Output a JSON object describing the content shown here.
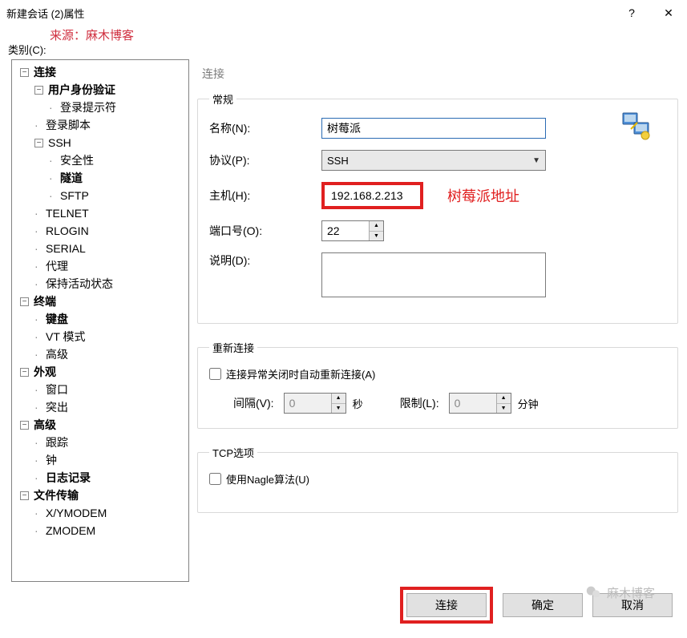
{
  "window": {
    "title": "新建会话 (2)属性",
    "help": "?",
    "close": "✕"
  },
  "watermark_top": "来源：麻木博客",
  "category_label": "类别(C):",
  "tree": {
    "connection": "连接",
    "user_auth": "用户身份验证",
    "login_prompt": "登录提示符",
    "login_script": "登录脚本",
    "ssh": "SSH",
    "security": "安全性",
    "tunnel": "隧道",
    "sftp": "SFTP",
    "telnet": "TELNET",
    "rlogin": "RLOGIN",
    "serial": "SERIAL",
    "proxy": "代理",
    "keepalive": "保持活动状态",
    "terminal": "终端",
    "keyboard": "键盘",
    "vtmode": "VT 模式",
    "advanced_term": "高级",
    "appearance": "外观",
    "window": "窗口",
    "highlight": "突出",
    "advanced": "高级",
    "trace": "跟踪",
    "bell": "钟",
    "logging": "日志记录",
    "filetransfer": "文件传输",
    "xymodem": "X/YMODEM",
    "zmodem": "ZMODEM"
  },
  "panel": {
    "heading": "连接",
    "general_legend": "常规",
    "name_label": "名称(N):",
    "name_value": "树莓派",
    "protocol_label": "协议(P):",
    "protocol_value": "SSH",
    "host_label": "主机(H):",
    "host_value": "192.168.2.213",
    "host_annotation": "树莓派地址",
    "port_label": "端口号(O):",
    "port_value": "22",
    "desc_label": "说明(D):",
    "reconnect_legend": "重新连接",
    "reconnect_cb": "连接异常关闭时自动重新连接(A)",
    "interval_label": "间隔(V):",
    "interval_value": "0",
    "interval_unit": "秒",
    "limit_label": "限制(L):",
    "limit_value": "0",
    "limit_unit": "分钟",
    "tcp_legend": "TCP选项",
    "nagle_cb": "使用Nagle算法(U)"
  },
  "buttons": {
    "connect": "连接",
    "ok": "确定",
    "cancel": "取消"
  },
  "watermark_bottom": "麻木博客"
}
